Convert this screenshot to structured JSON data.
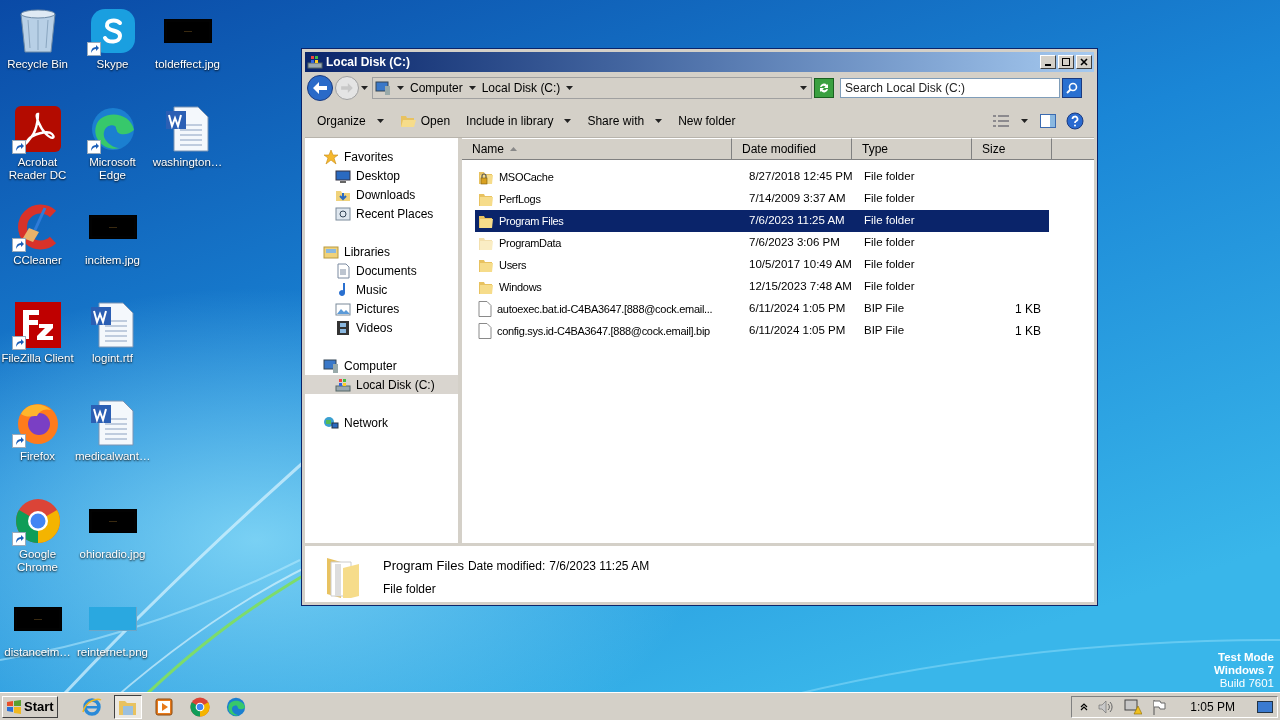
{
  "desktop": {
    "icons": [
      {
        "label": "Recycle Bin",
        "kind": "recycle-bin",
        "shortcut": false
      },
      {
        "label": "Acrobat Reader DC",
        "kind": "acrobat",
        "shortcut": true
      },
      {
        "label": "CCleaner",
        "kind": "ccleaner",
        "shortcut": true
      },
      {
        "label": "FileZilla Client",
        "kind": "filezilla",
        "shortcut": true
      },
      {
        "label": "Firefox",
        "kind": "firefox",
        "shortcut": true
      },
      {
        "label": "Google Chrome",
        "kind": "chrome",
        "shortcut": true
      },
      {
        "label": "distanceim…",
        "shortcut": false
      },
      {
        "label": "Skype",
        "kind": "skype",
        "shortcut": true
      },
      {
        "label": "Microsoft Edge",
        "kind": "edge",
        "shortcut": true
      },
      {
        "label": "incitem.jpg",
        "shortcut": false
      },
      {
        "label": "logint.rtf",
        "kind": "document",
        "shortcut": false
      },
      {
        "label": "medicalwant…",
        "kind": "document",
        "shortcut": false
      },
      {
        "label": "ohioradio.jpg",
        "shortcut": false
      },
      {
        "label": "reinternet.png",
        "kind": "blank",
        "shortcut": false
      },
      {
        "label": "toldeffect.jpg",
        "shortcut": false
      },
      {
        "label": "washington…",
        "kind": "document",
        "shortcut": false
      }
    ],
    "test_mode": [
      "Test Mode",
      "Windows 7",
      "Build 7601"
    ]
  },
  "window": {
    "title": "Local Disk (C:)",
    "breadcrumb": [
      "Computer",
      "Local Disk (C:)"
    ],
    "search": {
      "placeholder": "Search Local Disk (C:)"
    },
    "toolbar": [
      {
        "label": "Organize",
        "kind": "menu"
      },
      {
        "label": "Open",
        "kind": "open"
      },
      {
        "label": "Include in library",
        "kind": "menu"
      },
      {
        "label": "Share with",
        "kind": "menu"
      },
      {
        "label": "New folder",
        "kind": "plain"
      }
    ],
    "nav": [
      {
        "label": "Favorites",
        "kind": "star",
        "selected": false,
        "children": [
          {
            "label": "Desktop",
            "kind": "desktop",
            "selected": false
          },
          {
            "label": "Downloads",
            "kind": "downloads",
            "selected": false
          },
          {
            "label": "Recent Places",
            "kind": "recent",
            "selected": false
          }
        ]
      },
      {
        "label": "Libraries",
        "kind": "library",
        "selected": false,
        "children": [
          {
            "label": "Documents",
            "kind": "documents",
            "selected": false
          },
          {
            "label": "Music",
            "kind": "music",
            "selected": false
          },
          {
            "label": "Pictures",
            "kind": "pictures",
            "selected": false
          },
          {
            "label": "Videos",
            "kind": "videos",
            "selected": false
          }
        ]
      },
      {
        "label": "Computer",
        "kind": "computer",
        "selected": false,
        "children": [
          {
            "label": "Local Disk (C:)",
            "kind": "drive",
            "selected": true
          }
        ]
      },
      {
        "label": "Network",
        "kind": "network",
        "selected": false
      }
    ],
    "columns": [
      {
        "label": "Name",
        "sorted": true
      },
      {
        "label": "Date modified",
        "sorted": false
      },
      {
        "label": "Type",
        "sorted": false
      },
      {
        "label": "Size",
        "sorted": false
      }
    ],
    "rows": [
      {
        "kind": "locked-folder",
        "name": "MSOCache",
        "date": "8/27/2018 12:45 PM",
        "type": "File folder",
        "hidden": false,
        "selected": false
      },
      {
        "kind": "folder",
        "name": "PerfLogs",
        "date": "7/14/2009 3:37 AM",
        "type": "File folder",
        "hidden": false,
        "selected": false
      },
      {
        "kind": "folder",
        "name": "Program Files",
        "date": "7/6/2023 11:25 AM",
        "type": "File folder",
        "hidden": false,
        "selected": true
      },
      {
        "kind": "folder",
        "name": "ProgramData",
        "date": "7/6/2023 3:06 PM",
        "type": "File folder",
        "hidden": true,
        "selected": false
      },
      {
        "kind": "folder",
        "name": "Users",
        "date": "10/5/2017 10:49 AM",
        "type": "File folder",
        "hidden": false,
        "selected": false
      },
      {
        "kind": "folder",
        "name": "Windows",
        "date": "12/15/2023 7:48 AM",
        "type": "File folder",
        "hidden": false,
        "selected": false
      },
      {
        "kind": "file",
        "name": "autoexec.bat.id-C4BA3647.[888@cock.email...",
        "date": "6/11/2024 1:05 PM",
        "type": "BIP File",
        "size": "1 KB",
        "hidden": false,
        "selected": false
      },
      {
        "kind": "file",
        "name": "config.sys.id-C4BA3647.[888@cock.email].bip",
        "date": "6/11/2024 1:05 PM",
        "type": "BIP File",
        "size": "1 KB",
        "hidden": false,
        "selected": false
      }
    ],
    "details": {
      "name": "Program Files",
      "date_label": "Date modified:",
      "date": "7/6/2023 11:25 AM",
      "type": "File folder"
    }
  },
  "taskbar": {
    "start": "Start",
    "apps": [
      {
        "kind": "ie",
        "active": false
      },
      {
        "kind": "explorer",
        "active": true
      },
      {
        "kind": "player",
        "active": false
      },
      {
        "kind": "chrome",
        "active": false
      },
      {
        "kind": "edge",
        "active": false
      }
    ],
    "clock": "1:05 PM"
  }
}
